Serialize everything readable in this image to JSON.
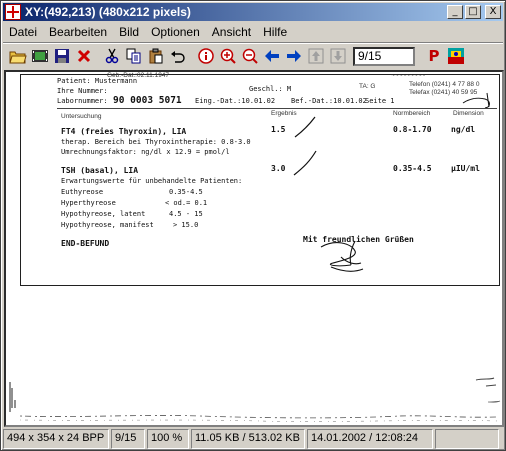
{
  "window": {
    "title": "XY:(492,213) (480x212 pixels)",
    "controls": {
      "minimize": "_",
      "maximize": "□",
      "close": "X"
    }
  },
  "menu": [
    "Datei",
    "Bearbeiten",
    "Bild",
    "Optionen",
    "Ansicht",
    "Hilfe"
  ],
  "toolbar": {
    "icons": [
      "open-folder",
      "filmstrip",
      "save-disk",
      "delete-x",
      "cut-scissors",
      "copy",
      "paste",
      "undo",
      "info",
      "zoom-in",
      "zoom-out",
      "arrow-left",
      "arrow-right",
      "page-up",
      "page-down",
      "print-p",
      "color-palette"
    ],
    "page_field": "9/15",
    "print_letter": "P"
  },
  "document": {
    "patient_label": "Patient: Mustermann",
    "nummer_label": "Ihre Nummer:",
    "labor_label": "Labornummer:",
    "labor_number": "90 0003 5071",
    "eing_dat": "Eing.-Dat.:10.01.02",
    "bef_dat": "Bef.-Dat.:10.01.02",
    "geb_dat": "Geb.-Dat.:02.11.1947",
    "geschl": "Geschl.:  M",
    "seite": "Seite  1",
    "ta": "TA: G",
    "telefon": "Telefon (0241) 4 77 88 0",
    "telefax": "Telefax (0241) 40 59 95",
    "col_untersuchung": "Untersuchung",
    "col_ergebnis": "Ergebnis",
    "col_normbereich": "Normbereich",
    "col_dimension": "Dimension",
    "ft4_name": "FT4 (freies Thyroxin), LIA",
    "ft4_value": "1.5",
    "ft4_range": "0.8-1.70",
    "ft4_unit": "ng/dl",
    "ft4_note1": "therap. Bereich bei Thyroxintherapie:  0.8-3.0",
    "ft4_note2": "Umrechnungsfaktor: ng/dl x 12.9 = pmol/l",
    "tsh_name": "TSH (basal), LIA",
    "tsh_value": "3.0",
    "tsh_range": "0.35-4.5",
    "tsh_unit": "µIU/ml",
    "tsh_note": "Erwartungswerte für unbehandelte Patienten:",
    "ref_rows": [
      {
        "label": "Euthyreose",
        "value": "0.35-4.5"
      },
      {
        "label": "Hyperthyreose",
        "value": "< od.= 0.1"
      },
      {
        "label": "Hypothyreose, latent",
        "value": "4.5 - 15"
      },
      {
        "label": "Hypothyreose, manifest",
        "value": "> 15.0"
      }
    ],
    "end_befund": "END-BEFUND",
    "greeting": "Mit freundlichen Grüßen"
  },
  "status": {
    "dimensions": "494 x 354 x 24 BPP",
    "page": "9/15",
    "zoom": "100 %",
    "filesize": "11.05 KB / 513.02 KB",
    "datetime": "14.01.2002 / 12:08:24"
  }
}
